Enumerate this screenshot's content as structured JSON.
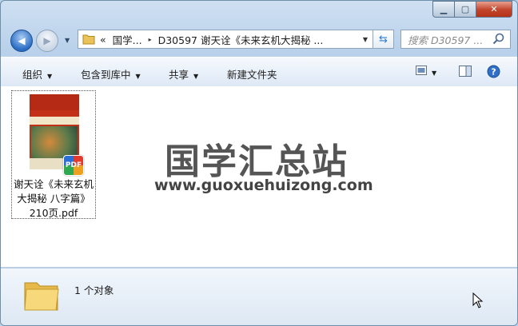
{
  "window": {
    "captions": {
      "minimize": "▁",
      "maximize": "▢",
      "close": "✕"
    }
  },
  "nav": {
    "back": "◀",
    "forward": "▶",
    "history_dropdown": "▼"
  },
  "address": {
    "overflow": "«",
    "segments": [
      "国学...",
      "D30597 谢天诠《未来玄机大揭秘 ..."
    ],
    "separator": "▸",
    "dropdown": "▼"
  },
  "refresh": "⇆",
  "search": {
    "placeholder": "搜索 D30597 ..."
  },
  "toolbar": {
    "organize": "组织",
    "include_in_library": "包含到库中",
    "share": "共享",
    "new_folder": "新建文件夹",
    "menu_arrow": "▼"
  },
  "file": {
    "name": "谢天诠《未来玄机大揭秘 八字篇》210页.pdf",
    "badge": "PDF"
  },
  "watermark": {
    "title": "国学汇总站",
    "url": "www.guoxuehuizong.com"
  },
  "details": {
    "count": "1 个对象"
  },
  "colors": {
    "accent": "#2a6cc4",
    "close": "#c2432a"
  }
}
